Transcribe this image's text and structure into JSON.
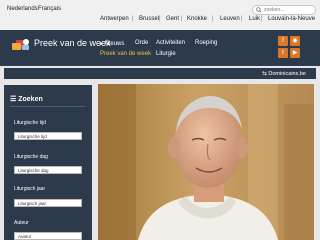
{
  "languages": [
    "Nederlands",
    "Français"
  ],
  "search": {
    "placeholder": "zoeken..."
  },
  "cities": [
    "Antwerpen",
    "Brussel",
    "Gent",
    "Knokke",
    "Leuven",
    "Luik",
    "Louvain-la-Neuve"
  ],
  "brand": {
    "name": "Preek van de week"
  },
  "nav": {
    "primary": [
      "Nieuws",
      "Orde",
      "Activiteiten",
      "Roeping"
    ],
    "secondary": [
      "Preek van de week",
      "Liturgie"
    ]
  },
  "social_icons": [
    "facebook-icon",
    "rss-icon",
    "twitter-icon",
    "youtube-icon"
  ],
  "strip": {
    "link": "Dominicains.be"
  },
  "sidebar": {
    "title": "Zoeken",
    "filters": [
      {
        "label": "Liturgische tijd",
        "value": "Liturgische tijd"
      },
      {
        "label": "Liturgische dag",
        "value": "Liturgische dag"
      },
      {
        "label": "Liturgisch jaar",
        "value": "Liturgisch jaar"
      },
      {
        "label": "Auteur",
        "value": "Auteur"
      }
    ]
  },
  "colors": {
    "header": "#2d3a4b",
    "accent": "#d9782b",
    "nav_active": "#f0c040"
  }
}
